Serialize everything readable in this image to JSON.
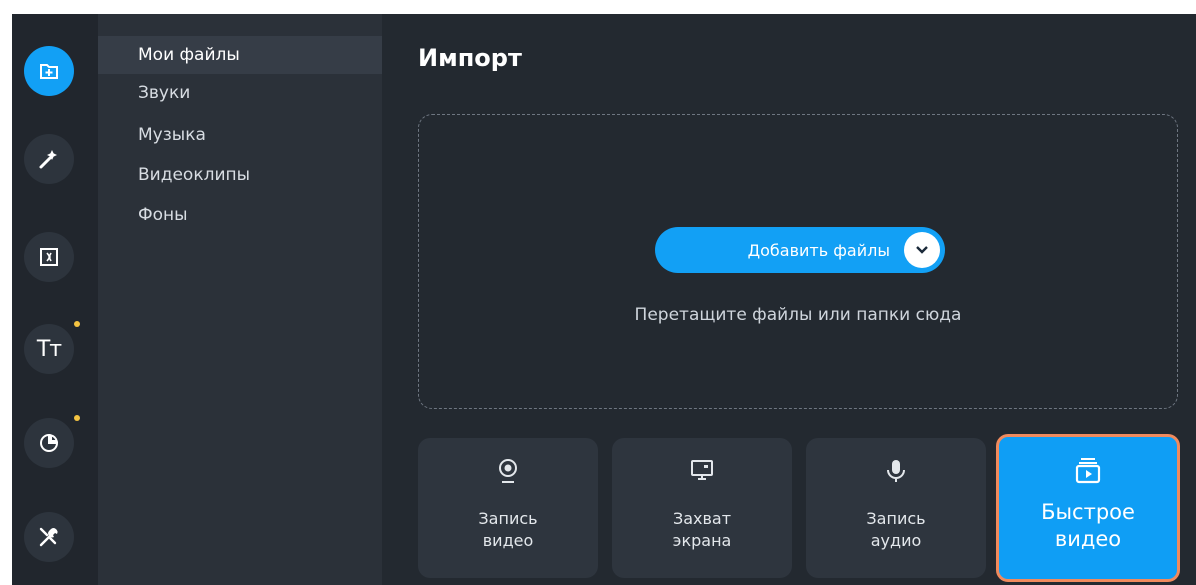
{
  "sidebar": {
    "icons": [
      {
        "name": "import-icon",
        "active": true,
        "dot": false
      },
      {
        "name": "magic-wand-icon",
        "active": false,
        "dot": false
      },
      {
        "name": "transitions-icon",
        "active": false,
        "dot": false
      },
      {
        "name": "titles-icon",
        "label": "Tт",
        "active": false,
        "dot": true
      },
      {
        "name": "stickers-icon",
        "active": false,
        "dot": true
      },
      {
        "name": "tools-icon",
        "active": false,
        "dot": false
      }
    ],
    "accent_color": "#12a0f5",
    "dot_color": "#f5c442"
  },
  "categories": [
    {
      "label": "Мои файлы",
      "active": true
    },
    {
      "label": "Звуки",
      "active": false
    },
    {
      "label": "Музыка",
      "active": false
    },
    {
      "label": "Видеоклипы",
      "active": false
    },
    {
      "label": "Фоны",
      "active": false
    }
  ],
  "main": {
    "title": "Импорт",
    "add_files_label": "Добавить файлы",
    "drop_hint": "Перетащите файлы или папки сюда",
    "tiles": [
      {
        "label_line1": "Запись",
        "label_line2": "видео",
        "icon": "webcam-icon"
      },
      {
        "label_line1": "Захват",
        "label_line2": "экрана",
        "icon": "monitor-icon"
      },
      {
        "label_line1": "Запись",
        "label_line2": "аудио",
        "icon": "microphone-icon"
      },
      {
        "label_line1": "Быстрое",
        "label_line2": "видео",
        "icon": "quick-video-icon",
        "highlighted": true
      }
    ],
    "highlight_color": "#f08a5d"
  }
}
